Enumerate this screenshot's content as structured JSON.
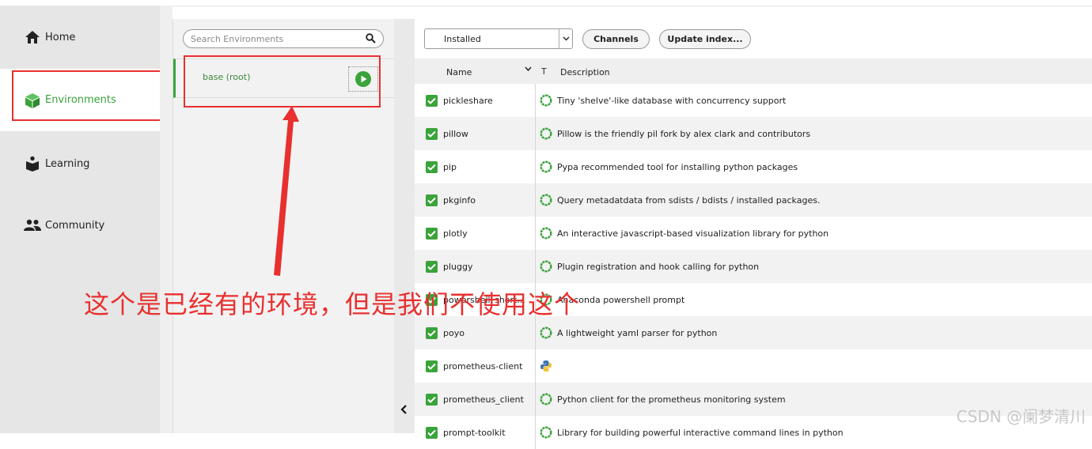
{
  "nav": {
    "items": [
      {
        "label": "Home",
        "icon": "home-icon"
      },
      {
        "label": "Environments",
        "icon": "cube-icon"
      },
      {
        "label": "Learning",
        "icon": "book-person-icon"
      },
      {
        "label": "Community",
        "icon": "people-icon"
      }
    ],
    "active": "Environments"
  },
  "env_panel": {
    "search_placeholder": "Search Environments",
    "environments": [
      {
        "name": "base (root)"
      }
    ]
  },
  "toolbar": {
    "filter_value": "Installed",
    "channels_label": "Channels",
    "update_label": "Update index..."
  },
  "table": {
    "col_name": "Name",
    "col_t": "T",
    "col_desc": "Description",
    "rows": [
      {
        "name": "pickleshare",
        "desc": "Tiny 'shelve'-like database with concurrency support",
        "status": "ring"
      },
      {
        "name": "pillow",
        "desc": "Pillow is the friendly pil fork by alex clark and contributors",
        "status": "ring"
      },
      {
        "name": "pip",
        "desc": "Pypa recommended tool for installing python packages",
        "status": "ring"
      },
      {
        "name": "pkginfo",
        "desc": "Query metadatdata from sdists / bdists / installed packages.",
        "status": "ring"
      },
      {
        "name": "plotly",
        "desc": "An interactive javascript-based visualization library for python",
        "status": "ring"
      },
      {
        "name": "pluggy",
        "desc": "Plugin registration and hook calling for python",
        "status": "ring"
      },
      {
        "name": "powershell_short...",
        "desc": "Anaconda powershell prompt",
        "status": "ring"
      },
      {
        "name": "poyo",
        "desc": "A lightweight yaml parser for python",
        "status": "ring"
      },
      {
        "name": "prometheus-client",
        "desc": "",
        "status": "python"
      },
      {
        "name": "prometheus_client",
        "desc": "Python client for the prometheus monitoring system",
        "status": "ring"
      },
      {
        "name": "prompt-toolkit",
        "desc": "Library for building powerful interactive command lines in python",
        "status": "ring"
      }
    ]
  },
  "annotation": {
    "text": "这个是已经有的环境，但是我们不使用这个"
  },
  "watermark": "CSDN @阑梦清川",
  "colors": {
    "accent": "#3aa33a",
    "annotation": "#e8302f"
  }
}
